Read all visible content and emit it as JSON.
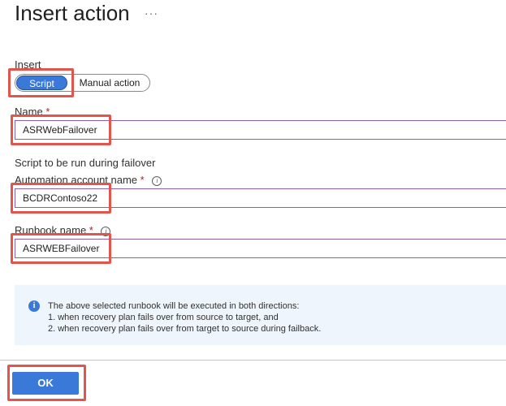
{
  "header": {
    "title": "Insert action",
    "more_icon": "ellipsis-icon",
    "more_glyph": "···"
  },
  "insert": {
    "label": "Insert",
    "options": [
      "Script",
      "Manual action"
    ],
    "selected": "Script"
  },
  "name_field": {
    "label": "Name",
    "required_marker": "*",
    "value": "ASRWebFailover"
  },
  "script_section": {
    "heading": "Script to be run during failover"
  },
  "automation_field": {
    "label": "Automation account name",
    "required_marker": "*",
    "info_icon": "info-icon",
    "value": "BCDRContoso22"
  },
  "runbook_field": {
    "label": "Runbook name",
    "required_marker": "*",
    "info_icon": "info-icon",
    "value": "ASRWEBFailover"
  },
  "info_box": {
    "icon": "info-circle-icon",
    "lines": [
      "The above selected runbook will be executed in both directions:",
      "1. when recovery plan fails over from source to target, and",
      "2. when recovery plan fails over from target to source during failback."
    ]
  },
  "footer": {
    "ok_label": "OK"
  },
  "colors": {
    "accent": "#3b79d8",
    "highlight": "#e0564f",
    "field_border": "#8a5ea8",
    "info_background": "#eef5fd"
  }
}
